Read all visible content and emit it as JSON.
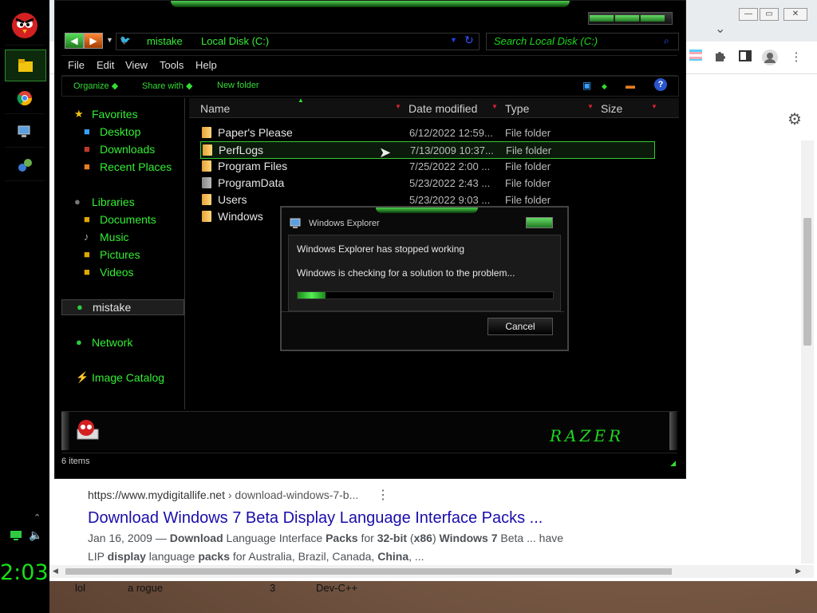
{
  "browser": {
    "result": {
      "url_host": "https://www.mydigitallife.net",
      "url_path": " › download-windows-7-b...",
      "more": "⋮",
      "title": "Download Windows 7 Beta Display Language Interface Packs ...",
      "snippet_line1_parts": [
        "Jan 16, 2009 — ",
        "Download",
        " Language Interface ",
        "Packs",
        " for ",
        "32-bit",
        " (",
        "x86",
        ") ",
        "Windows 7",
        " Beta ... have"
      ],
      "snippet_line2_parts": [
        "LIP ",
        "display",
        " language ",
        "packs",
        " for Australia, Brazil, Canada, ",
        "China",
        ", ..."
      ]
    },
    "window_buttons": [
      "—",
      "▭",
      "✕"
    ],
    "tab_chevron": "⌄"
  },
  "dock": {
    "clock": "2:03"
  },
  "taskbar": {
    "labels": [
      "lol",
      "a rogue",
      "3",
      "Dev-C++"
    ]
  },
  "explorer": {
    "address": {
      "segments": [
        "mistake",
        "Local Disk (C:)"
      ]
    },
    "search_placeholder": "Search Local Disk (C:)",
    "menu": [
      "File",
      "Edit",
      "View",
      "Tools",
      "Help"
    ],
    "commands": [
      "Organize",
      "Share with",
      "New folder"
    ],
    "help_label": "?",
    "nav": {
      "favorites": "Favorites",
      "favorites_items": [
        "Desktop",
        "Downloads",
        "Recent Places"
      ],
      "libraries": "Libraries",
      "libraries_items": [
        "Documents",
        "Music",
        "Pictures",
        "Videos"
      ],
      "homegroup": "mistake",
      "network": "Network",
      "image_catalog": "Image Catalog"
    },
    "columns": [
      "Name",
      "Date modified",
      "Type",
      "Size"
    ],
    "files": [
      {
        "name": "Paper's Please",
        "date": "6/12/2022 12:59...",
        "type": "File folder"
      },
      {
        "name": "PerfLogs",
        "date": "7/13/2009 10:37...",
        "type": "File folder"
      },
      {
        "name": "Program Files",
        "date": "7/25/2022 2:00 ...",
        "type": "File folder"
      },
      {
        "name": "ProgramData",
        "date": "5/23/2022 2:43 ...",
        "type": "File folder"
      },
      {
        "name": "Users",
        "date": "5/23/2022 9:03 ...",
        "type": "File folder"
      },
      {
        "name": "Windows",
        "date": "",
        "type": ""
      }
    ],
    "selected_index": 1,
    "details_logo": "RAZER",
    "status": "6 items"
  },
  "dialog": {
    "title": "Windows Explorer",
    "message1": "Windows Explorer has stopped working",
    "message2": "Windows is checking for a solution to the problem...",
    "progress_fraction": 0.11,
    "cancel_label": "Cancel"
  }
}
